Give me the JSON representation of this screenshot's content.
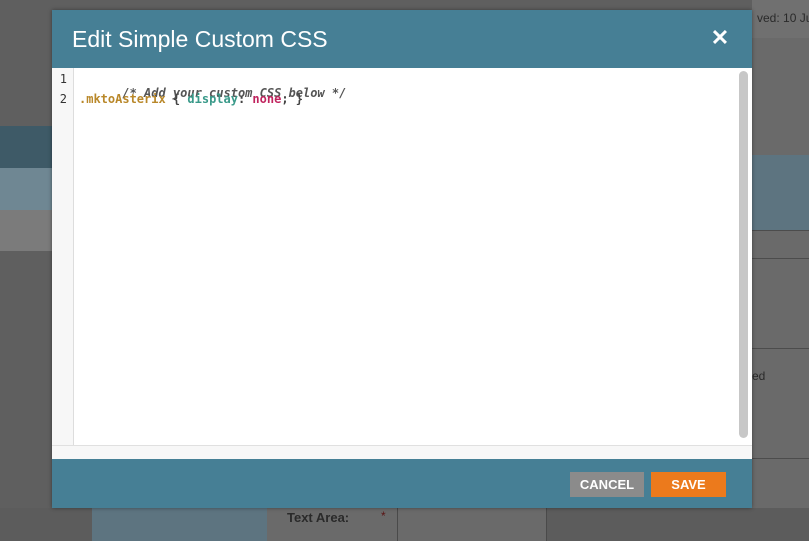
{
  "background": {
    "saved_text": "ved: 10 Ju",
    "partial_text": "ed",
    "textarea_label": "Text Area:",
    "required_marker": "*"
  },
  "modal": {
    "title": "Edit Simple Custom CSS",
    "close_icon": "close-icon",
    "editor": {
      "line_numbers": [
        "1",
        "2"
      ],
      "line1_comment": "/* Add your custom CSS below */",
      "line2_selector": ".mktoAsterix",
      "line2_open": " { ",
      "line2_property": "display",
      "line2_colon": ": ",
      "line2_value": "none",
      "line2_close": "; }"
    },
    "footer": {
      "cancel_label": "CANCEL",
      "save_label": "SAVE"
    }
  },
  "colors": {
    "header_bg": "#467f95",
    "save_button": "#ec7a1c",
    "cancel_button": "#8b8b8b"
  }
}
